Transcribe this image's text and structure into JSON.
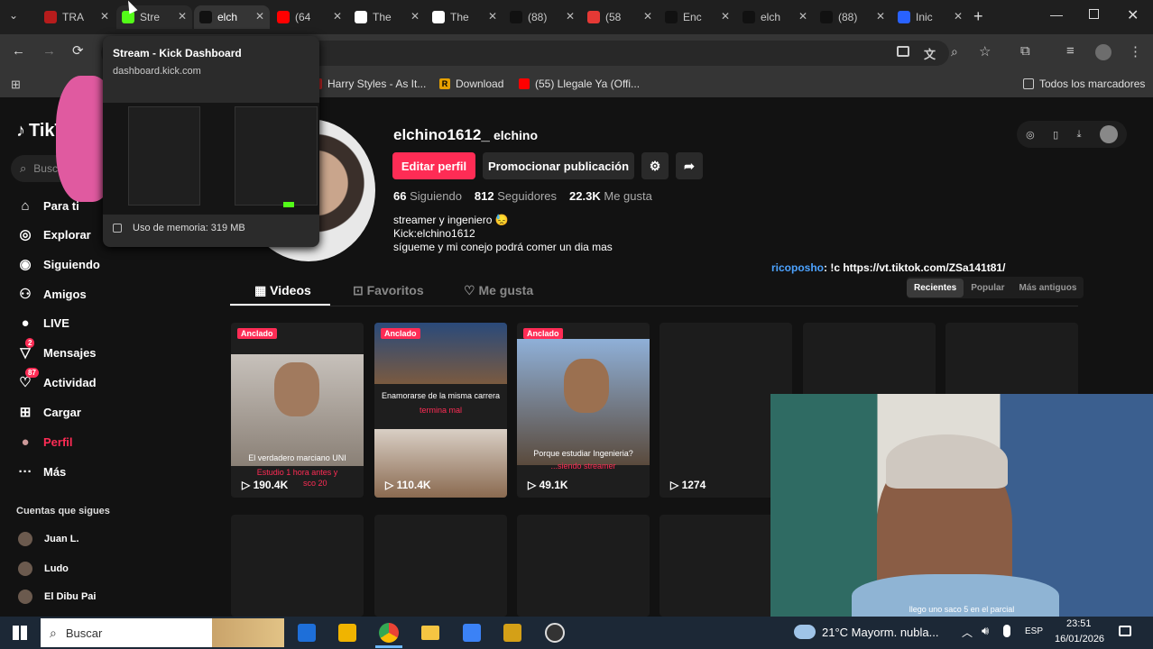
{
  "browser": {
    "tabs": [
      {
        "label": "TRA",
        "color": "#b71c1c"
      },
      {
        "label": "Stre",
        "color": "#53fc18"
      },
      {
        "label": "elch",
        "color": "#111111",
        "active": true
      },
      {
        "label": "(64",
        "color": "#ff0000"
      },
      {
        "label": "The",
        "color": "#ffffff"
      },
      {
        "label": "The",
        "color": "#ffffff"
      },
      {
        "label": "(88)",
        "color": "#111111"
      },
      {
        "label": "(58",
        "color": "#e53935"
      },
      {
        "label": "Enc",
        "color": "#111111"
      },
      {
        "label": "elch",
        "color": "#111111"
      },
      {
        "label": "(88)",
        "color": "#111111"
      },
      {
        "label": "Inic",
        "color": "#2962ff"
      }
    ],
    "new_tab": "+",
    "bookmarks": [
      {
        "label": "Harry Styles - As It...",
        "color": "#c62828"
      },
      {
        "label": "Download",
        "color": "#e6a100",
        "glyph": "R"
      },
      {
        "label": "(55) Llegale Ya (Offi...",
        "color": "#ff0000"
      }
    ],
    "all_bookmarks": "Todos los marcadores"
  },
  "tab_preview": {
    "title": "Stream - Kick Dashboard",
    "url": "dashboard.kick.com",
    "memory": "Uso de memoria: 319 MB"
  },
  "sidebar": {
    "logo": "TikT",
    "search_placeholder": "Buscar",
    "items": [
      {
        "label": "Para ti",
        "icon": "home-icon"
      },
      {
        "label": "Explorar",
        "icon": "compass-icon"
      },
      {
        "label": "Siguiendo",
        "icon": "following-icon"
      },
      {
        "label": "Amigos",
        "icon": "friends-icon"
      },
      {
        "label": "LIVE",
        "icon": "live-icon"
      },
      {
        "label": "Mensajes",
        "icon": "messages-icon",
        "badge": "2"
      },
      {
        "label": "Actividad",
        "icon": "activity-icon",
        "badge": "87"
      },
      {
        "label": "Cargar",
        "icon": "upload-icon"
      },
      {
        "label": "Perfil",
        "icon": "avatar",
        "accent": "#fe2c55"
      },
      {
        "label": "Más",
        "icon": "more-icon"
      }
    ],
    "following_title": "Cuentas que sigues",
    "following": [
      "Juan L.",
      "Ludo",
      "El Dibu Pai"
    ]
  },
  "profile": {
    "username": "elchino1612_",
    "nickname": "elchino",
    "edit_button": "Editar perfil",
    "promote_button": "Promocionar publicación",
    "stats": [
      {
        "value": "66",
        "label": "Siguiendo"
      },
      {
        "value": "812",
        "label": "Seguidores"
      },
      {
        "value": "22.3K",
        "label": "Me gusta"
      }
    ],
    "bio": [
      "streamer y ingeniero 😓",
      "Kick:elchino1612",
      "sígueme y mi conejo podrá comer un dia mas"
    ],
    "chat_user": "ricoposho",
    "chat_text": ": !c https://vt.tiktok.com/ZSa141t81/",
    "tabs": [
      "Videos",
      "Favoritos",
      "Me gusta"
    ],
    "sort": [
      "Recientes",
      "Popular",
      "Más antiguos"
    ]
  },
  "videos": [
    {
      "pinned": "Anclado",
      "views": "190.4K",
      "caption": "El verdadero marciano UNI",
      "sub": "Estudio 1 hora antes y",
      "sub2": "sco 20"
    },
    {
      "pinned": "Anclado",
      "views": "110.4K",
      "caption": "Enamorarse de la misma carrera",
      "sub": "termina mal"
    },
    {
      "pinned": "Anclado",
      "views": "49.1K",
      "caption": "Porque estudiar Ingenieria?",
      "sub": "...siendo streamer"
    },
    {
      "views": "1274"
    }
  ],
  "webcam_caption": "llego uno saco 5 en el parcial",
  "taskbar": {
    "search": "Buscar",
    "weather": "21°C  Mayorm. nubla...",
    "lang": "ESP",
    "time": "23:51",
    "date": "16/01/2026"
  },
  "colors": {
    "accent": "#fe2c55",
    "kick": "#53fc18"
  }
}
